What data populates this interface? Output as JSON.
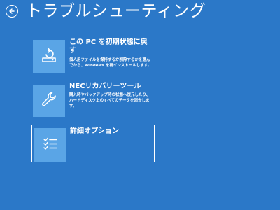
{
  "page": {
    "title": "トラブルシューティング",
    "back_icon": "back-arrow-icon"
  },
  "colors": {
    "background": "#2b78c8",
    "tile": "#5aa5e6",
    "text": "#ffffff"
  },
  "options": [
    {
      "title": "この PC を初期状態に戻す",
      "description": "個人用ファイルを保持するか削除するかを選んでから、Windows を再インストールします。",
      "icon": "reset-pc-icon",
      "selected": false
    },
    {
      "title": "NECリカバリーツール",
      "description": "購入時やバックアップ時の状態へ復元したり、ハードディスク上のすべてのデータを消去します。",
      "icon": "wrench-icon",
      "selected": false
    },
    {
      "title": "詳細オプション",
      "description": "",
      "icon": "checklist-icon",
      "selected": true
    }
  ]
}
